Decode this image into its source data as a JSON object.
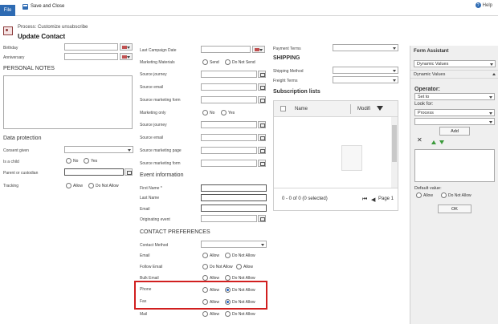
{
  "ribbon": {
    "file_label": "File",
    "save_close_label": "Save and Close",
    "help_label": "Help"
  },
  "header": {
    "process_subtitle": "Process: Customize unsubscribe",
    "title": "Update Contact"
  },
  "col1": {
    "birthday_label": "Birthday",
    "anniversary_label": "Anniversary",
    "personal_notes_header": "PERSONAL NOTES",
    "data_protection_header": "Data protection",
    "consent_given_label": "Consent given",
    "is_child_label": "Is a child",
    "is_child_no": "No",
    "is_child_yes": "Yes",
    "parent_label": "Parent or custodian",
    "tracking_label": "Tracking",
    "tracking_allow": "Allow",
    "tracking_do_not_allow": "Do Not Allow"
  },
  "col2": {
    "last_campaign_date": "Last Campaign Date",
    "marketing_materials": "Marketing Materials",
    "mm_send": "Send",
    "mm_do_not_send": "Do Not Send",
    "source_journey_1": "Source journey",
    "source_email_1": "Source email",
    "source_marketing_form_1": "Source marketing form",
    "marketing_only": "Marketing only",
    "mo_no": "No",
    "mo_yes": "Yes",
    "source_journey_2": "Source journey",
    "source_email_2": "Source email",
    "source_marketing_page": "Source marketing page",
    "source_marketing_form_2": "Source marketing form",
    "event_info_header": "Event information",
    "first_name": "First Name *",
    "last_name": "Last Name",
    "email": "Email",
    "originating_event": "Originating event",
    "contact_pref_header": "CONTACT PREFERENCES",
    "contact_method": "Contact Method",
    "email_pref": "Email",
    "follow_email": "Follow Email",
    "bulk_email": "Bulk Email",
    "phone": "Phone",
    "fax": "Fax",
    "mail": "Mail",
    "allow": "Allow",
    "do_not_allow": "Do Not Allow"
  },
  "col3": {
    "payment_terms": "Payment Terms",
    "shipping_header": "SHIPPING",
    "shipping_method": "Shipping Method",
    "freight_terms": "Freight Terms",
    "subscription_lists": "Subscription lists",
    "grid_col_name": "Name",
    "grid_col_modified": "Modifi",
    "grid_footer_count": "0 - 0 of 0 (0 selected)",
    "grid_page": "Page 1"
  },
  "assistant": {
    "title": "Form Assistant",
    "dropdown_value": "Dynamic Values",
    "section_label": "Dynamic Values",
    "operator_label": "Operator:",
    "operator_value": "Set to",
    "look_for_label": "Look for:",
    "look_for_value": "Process",
    "add_button": "Add",
    "default_value_label": "Default value:",
    "dv_allow": "Allow",
    "dv_do_not_allow": "Do Not Allow",
    "ok_button": "OK"
  }
}
